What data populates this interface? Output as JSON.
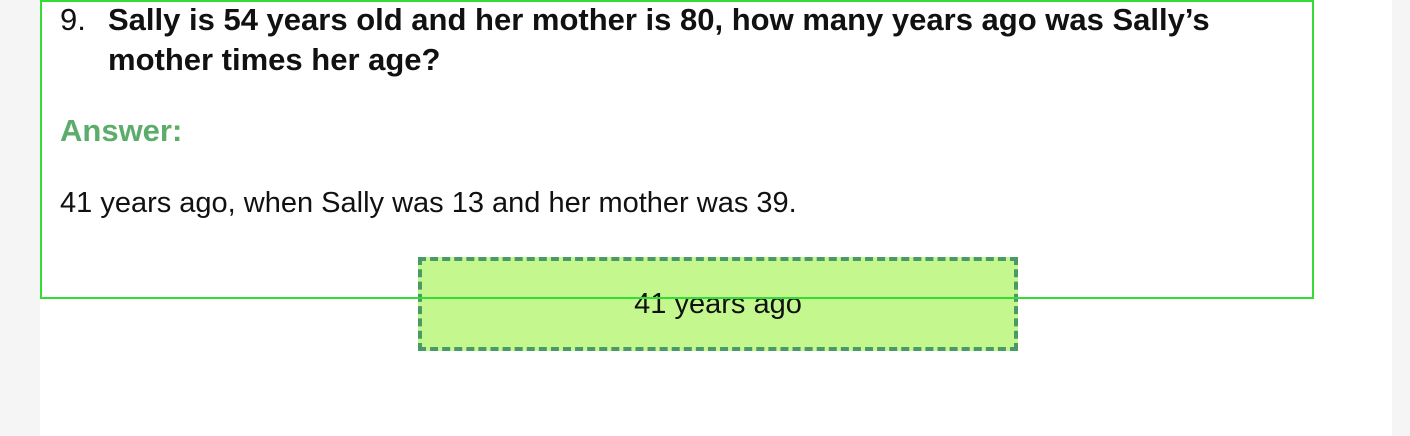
{
  "question": {
    "number": "9.",
    "text": "Sally is 54 years old and her mother is 80, how many years ago was Sally’s mother times her age?"
  },
  "answer": {
    "heading": "Answer:",
    "text": "41 years ago, when Sally was 13 and her mother was 39."
  },
  "answer_chip": {
    "label": "41 years ago"
  },
  "colors": {
    "answer_heading": "#5cad6c",
    "highlight_outline": "#33dd33",
    "chip_fill": "#c4f88e",
    "chip_border": "#4a9a68"
  }
}
